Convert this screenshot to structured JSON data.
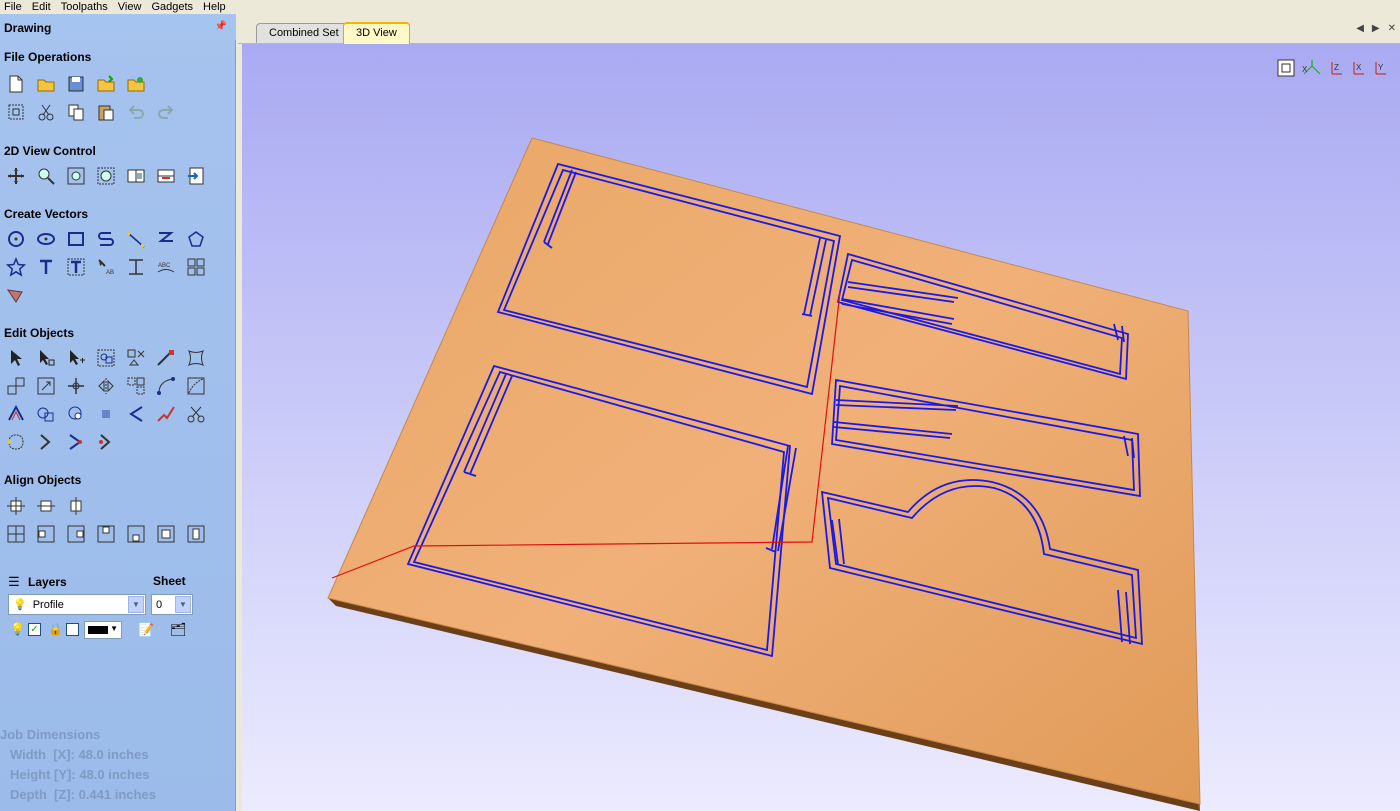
{
  "menu": [
    "File",
    "Edit",
    "Toolpaths",
    "View",
    "Gadgets",
    "Help"
  ],
  "panel": {
    "title": "Drawing"
  },
  "sections": {
    "file_ops": "File Operations",
    "view_ctrl": "2D View Control",
    "create_vectors": "Create Vectors",
    "edit_objects": "Edit Objects",
    "align_objects": "Align Objects"
  },
  "layers": {
    "label": "Layers",
    "sheet_label": "Sheet",
    "layer_value": "Profile",
    "sheet_value": "0"
  },
  "job": {
    "title": "Job Dimensions",
    "width": "Width  [X]: 48.0 inches",
    "height": "Height [Y]: 48.0 inches",
    "depth": "Depth  [Z]: 0.441 inches"
  },
  "tabs": [
    "Combined Set",
    "3D View"
  ],
  "view_icons": [
    "zoom-extents-icon",
    "iso-view-icon",
    "top-view-icon",
    "front-view-icon",
    "left-view-icon",
    "right-view-icon"
  ],
  "colors": {
    "board": "#e8a464",
    "board_edge": "#7a4a20",
    "vectors": "#1a1ae6",
    "toolpath": "#e01010",
    "background_top": "#a9aaf2",
    "background_bottom": "#ecebff"
  }
}
